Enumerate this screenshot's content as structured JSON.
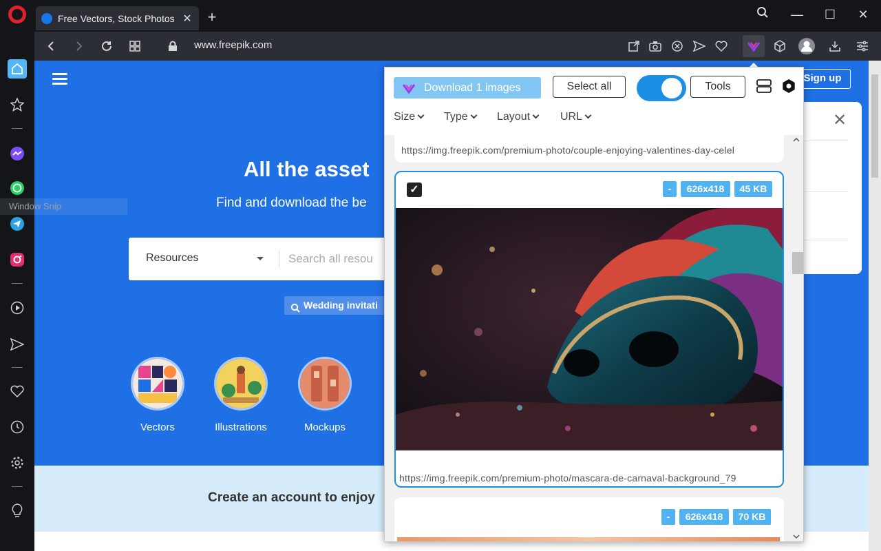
{
  "browser": {
    "tab_title": "Free Vectors, Stock Photos",
    "url": "www.freepik.com"
  },
  "overlay": {
    "window_snip": "Window Snip"
  },
  "page": {
    "hero_title": "All the asset",
    "hero_sub": "Find and download the be",
    "search_type": "Resources",
    "search_placeholder": "Search all resou",
    "chip": "Wedding invitati",
    "categories": [
      "Vectors",
      "Illustrations",
      "Mockups"
    ],
    "create_text": "Create an account to enjoy",
    "signup": "Sign up"
  },
  "popup": {
    "download_label": "Download 1 images",
    "select_all": "Select all",
    "tools": "Tools",
    "filters": [
      "Size",
      "Type",
      "Layout",
      "URL"
    ],
    "prev_url": "https://img.freepik.com/premium-photo/couple-enjoying-valentines-day-celel",
    "card1": {
      "tags": [
        "-",
        "626x418",
        "45 KB"
      ],
      "url": "https://img.freepik.com/premium-photo/mascara-de-carnaval-background_79"
    },
    "card2": {
      "tags": [
        "-",
        "626x418",
        "70 KB"
      ]
    }
  },
  "colors": {
    "accent": "#1e8fe6",
    "freepik_blue": "#1f6fe5",
    "opera_red": "#e2212d"
  }
}
